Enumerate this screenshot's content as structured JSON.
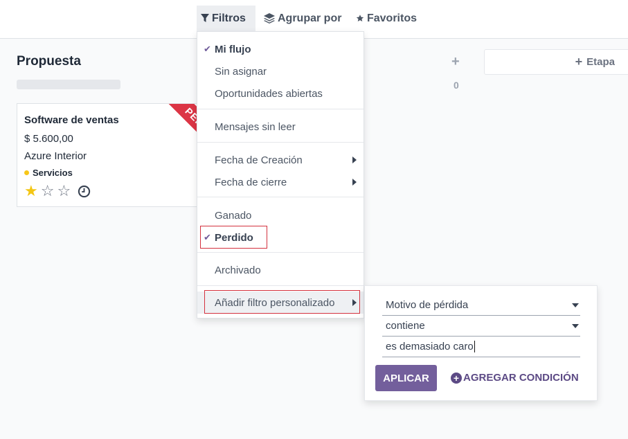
{
  "toolbar": {
    "filters_label": "Filtros",
    "group_by_label": "Agrupar por",
    "favorites_label": "Favoritos"
  },
  "kanban": {
    "column_title": "Propuesta",
    "card": {
      "name": "Software de ventas",
      "amount": "$ 5.600,00",
      "partner": "Azure Interior",
      "tag": "Servicios",
      "ribbon": "PERDIDO",
      "priority_stars": 1,
      "priority_max": 3
    },
    "next_column_plus": "+",
    "next_column_count": "0",
    "add_stage_label": "Etapa"
  },
  "filters_menu": {
    "items": [
      {
        "label": "Mi flujo",
        "checked": true
      },
      {
        "label": "Sin asignar",
        "checked": false
      },
      {
        "label": "Oportunidades abiertas",
        "checked": false
      },
      {
        "label": "Mensajes sin leer",
        "checked": false
      },
      {
        "label": "Fecha de Creación",
        "checked": false,
        "submenu": true
      },
      {
        "label": "Fecha de cierre",
        "checked": false,
        "submenu": true
      },
      {
        "label": "Ganado",
        "checked": false
      },
      {
        "label": "Perdido",
        "checked": true
      },
      {
        "label": "Archivado",
        "checked": false
      },
      {
        "label": "Añadir filtro personalizado",
        "checked": false,
        "submenu": true
      }
    ]
  },
  "custom_filter": {
    "field": "Motivo de pérdida",
    "operator": "contiene",
    "value": "es demasiado caro",
    "apply_label": "APLICAR",
    "add_condition_label": "AGREGAR CONDICIÓN"
  },
  "colors": {
    "primary": "#735f9c",
    "ribbon": "#dc3545",
    "star": "#f3c614",
    "tag_dot": "#f7c719",
    "highlight_box": "#d3303d"
  }
}
